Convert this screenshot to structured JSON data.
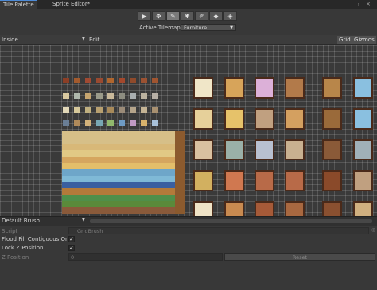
{
  "tabs": [
    {
      "label": "Tile Palette"
    },
    {
      "label": "Sprite Editor*"
    }
  ],
  "window_controls": {
    "more": "⋮",
    "close": "×"
  },
  "toolbar": {
    "tools": [
      {
        "name": "select-tool",
        "glyph": "▶"
      },
      {
        "name": "move-tool",
        "glyph": "✥"
      },
      {
        "name": "paint-tool",
        "glyph": "✎"
      },
      {
        "name": "box-fill-tool",
        "glyph": "✱"
      },
      {
        "name": "picker-tool",
        "glyph": "✐"
      },
      {
        "name": "erase-tool",
        "glyph": "◆"
      },
      {
        "name": "fill-tool",
        "glyph": "◈"
      }
    ],
    "active_tilemap_label": "Active Tilemap",
    "active_tilemap_value": "Furniture"
  },
  "palette": {
    "name": "Inside",
    "edit_label": "Edit",
    "grid_label": "Grid",
    "gizmos_label": "Gizmos"
  },
  "brush": {
    "name": "Default Brush"
  },
  "inspector": {
    "script_label": "Script",
    "script_value": "GridBrush",
    "flood_fill_label": "Flood Fill Contiguous Only",
    "flood_fill_checked": "✓",
    "lock_z_label": "Lock Z Position",
    "lock_z_checked": "✓",
    "z_position_label": "Z Position",
    "z_position_value": "0",
    "reset_label": "Reset"
  }
}
